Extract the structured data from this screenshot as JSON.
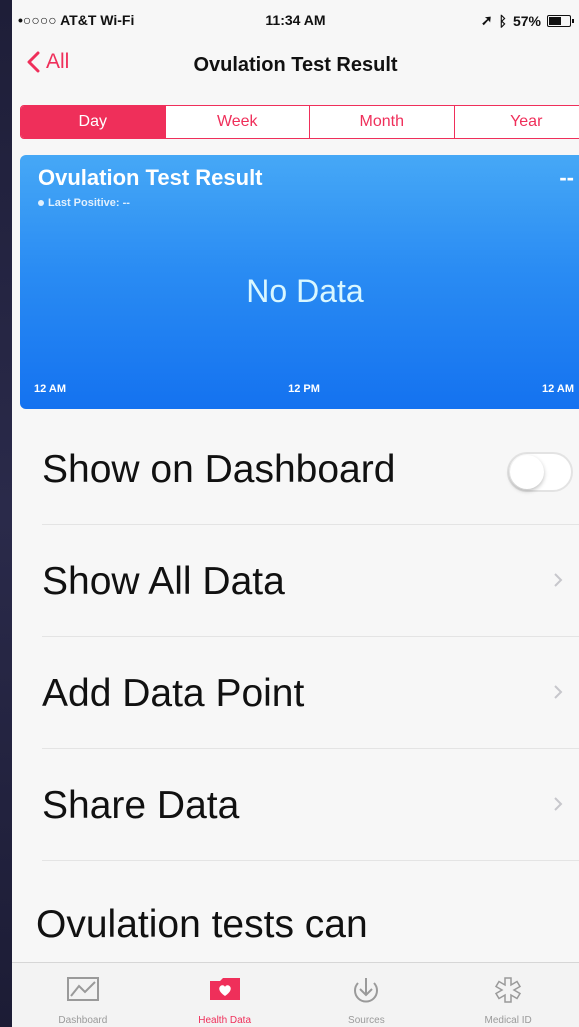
{
  "status_bar": {
    "carrier": "•○○○○ AT&T Wi-Fi",
    "time": "11:34 AM",
    "battery": "57%"
  },
  "nav": {
    "back_label": "All",
    "title": "Ovulation Test Result"
  },
  "segments": [
    {
      "label": "Day",
      "active": true
    },
    {
      "label": "Week",
      "active": false
    },
    {
      "label": "Month",
      "active": false
    },
    {
      "label": "Year",
      "active": false
    }
  ],
  "card": {
    "title": "Ovulation Test Result",
    "subtitle": "Last Positive: --",
    "value": "--",
    "no_data": "No Data",
    "axis": [
      "12 AM",
      "12 PM",
      "12 AM"
    ]
  },
  "rows": [
    {
      "label": "Show on Dashboard",
      "type": "toggle",
      "on": false
    },
    {
      "label": "Show All Data",
      "type": "chevron"
    },
    {
      "label": "Add Data Point",
      "type": "chevron"
    },
    {
      "label": "Share Data",
      "type": "chevron"
    }
  ],
  "section_text": "Ovulation tests can",
  "tabbar": [
    {
      "label": "Dashboard",
      "icon": "dashboard-icon",
      "active": false
    },
    {
      "label": "Health Data",
      "icon": "health-data-icon",
      "active": true
    },
    {
      "label": "Sources",
      "icon": "sources-icon",
      "active": false
    },
    {
      "label": "Medical ID",
      "icon": "medical-id-icon",
      "active": false
    }
  ],
  "colors": {
    "accent": "#ef2f5a",
    "card_top": "#46a8f6",
    "card_bottom": "#1472f0"
  }
}
